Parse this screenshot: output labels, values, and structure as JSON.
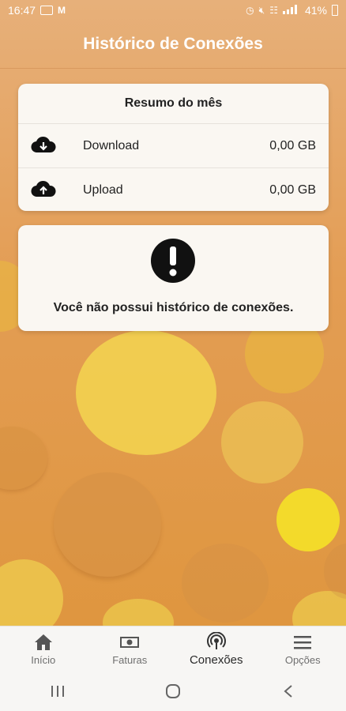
{
  "status_bar": {
    "time": "16:47",
    "battery": "41%"
  },
  "header": {
    "title": "Histórico de Conexões"
  },
  "summary": {
    "title": "Resumo do mês",
    "rows": [
      {
        "label": "Download",
        "value": "0,00 GB",
        "icon": "cloud-download-icon"
      },
      {
        "label": "Upload",
        "value": "0,00 GB",
        "icon": "cloud-upload-icon"
      }
    ]
  },
  "empty_state": {
    "icon": "exclamation-icon",
    "message": "Você não possui histórico de conexões."
  },
  "tabs": [
    {
      "label": "Início",
      "icon": "home-icon"
    },
    {
      "label": "Faturas",
      "icon": "bill-icon"
    },
    {
      "label": "Conexões",
      "icon": "connections-icon",
      "active": true
    },
    {
      "label": "Opções",
      "icon": "menu-icon"
    }
  ],
  "colors": {
    "accent": "#e39d54",
    "bubble": "#f0d24a"
  }
}
